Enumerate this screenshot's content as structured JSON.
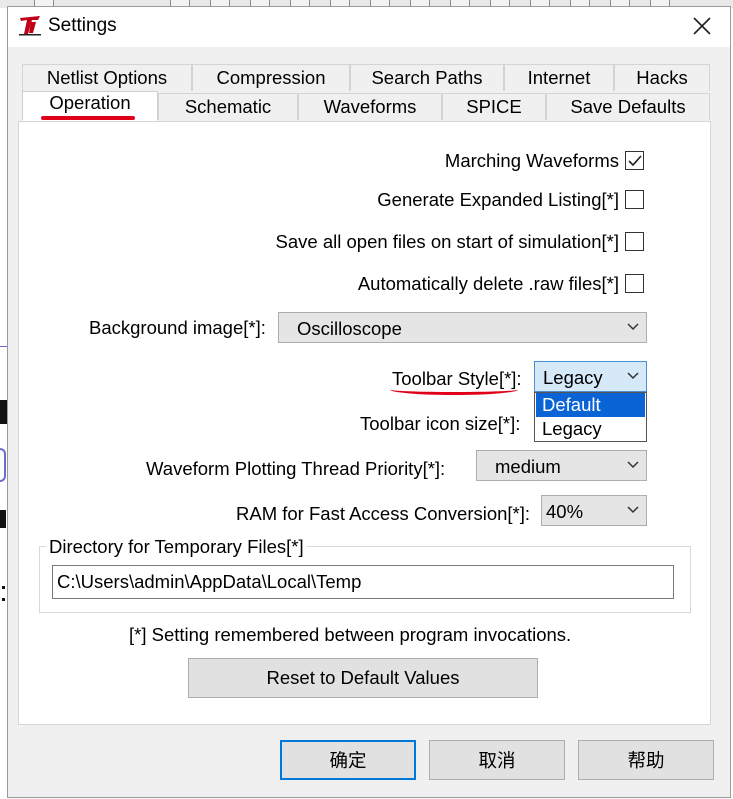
{
  "window": {
    "title": "Settings"
  },
  "tabs_row1": [
    {
      "label": "Netlist Options"
    },
    {
      "label": "Compression"
    },
    {
      "label": "Search Paths"
    },
    {
      "label": "Internet"
    },
    {
      "label": "Hacks"
    }
  ],
  "tabs_row2": [
    {
      "label": "Operation",
      "active": true
    },
    {
      "label": "Schematic"
    },
    {
      "label": "Waveforms"
    },
    {
      "label": "SPICE"
    },
    {
      "label": "Save Defaults"
    }
  ],
  "options": {
    "marching_waveforms": {
      "label": "Marching Waveforms",
      "checked": true
    },
    "expanded_listing": {
      "label": "Generate Expanded Listing[*]",
      "checked": false
    },
    "save_open_files": {
      "label": "Save all open files on start of simulation[*]",
      "checked": false
    },
    "auto_delete_raw": {
      "label": "Automatically delete .raw files[*]",
      "checked": false
    },
    "background_image": {
      "label": "Background image[*]:",
      "value": "Oscilloscope"
    },
    "toolbar_style": {
      "label": "Toolbar Style[*]:",
      "value": "Legacy",
      "options": [
        "Default",
        "Legacy"
      ],
      "highlighted": "Default"
    },
    "toolbar_icon_size": {
      "label": "Toolbar icon size[*]:"
    },
    "thread_priority": {
      "label": "Waveform Plotting Thread Priority[*]:",
      "value": "medium"
    },
    "ram_conversion": {
      "label": "RAM for Fast Access Conversion[*]:",
      "value": "40%"
    }
  },
  "temp_dir": {
    "group_label": "Directory for Temporary Files[*]",
    "value": "C:\\Users\\admin\\AppData\\Local\\Temp"
  },
  "note": "[*] Setting remembered between program invocations.",
  "buttons": {
    "reset": "Reset to Default Values",
    "ok": "确定",
    "cancel": "取消",
    "help": "帮助"
  },
  "colors": {
    "annotation": "#e0001a",
    "selection": "#0a64d6",
    "focus_border": "#0078d7"
  }
}
